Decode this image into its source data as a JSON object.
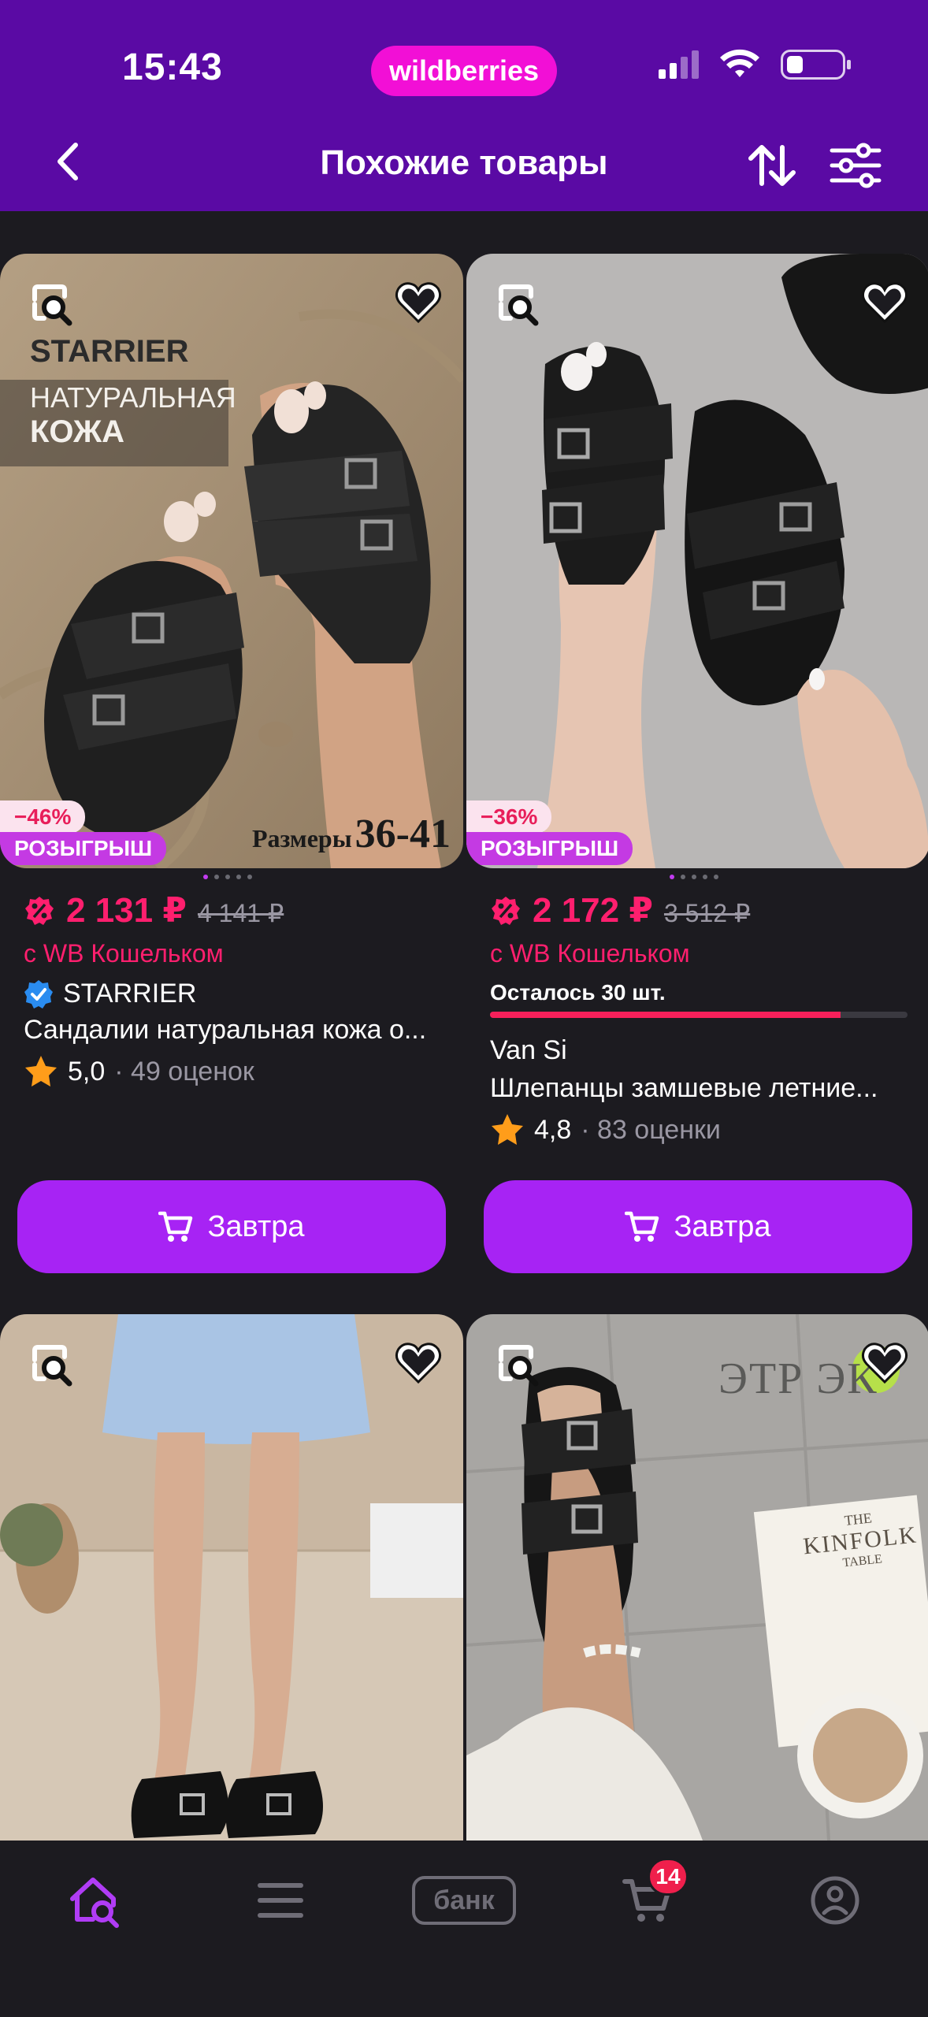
{
  "status_bar": {
    "time": "15:43",
    "brand": "wildberries"
  },
  "header": {
    "title": "Похожие товары"
  },
  "products": [
    {
      "discount": "−46%",
      "promo": "РОЗЫГРЫШ",
      "price": "2 131 ₽",
      "old_price": "4 141 ₽",
      "wallet_note": "с WB Кошельком",
      "brand": "STARRIER",
      "verified": true,
      "title": "Сандалии натуральная кожа о...",
      "rating": "5,0",
      "reviews": "· 49 оценок",
      "button": "Завтра",
      "image_overlay": {
        "line1": "STARRIER",
        "line2": "НАТУРАЛЬНАЯ",
        "line3": "КОЖА",
        "sizes_label": "Размеры",
        "sizes": "36-41"
      }
    },
    {
      "discount": "−36%",
      "promo": "РОЗЫГРЫШ",
      "price": "2 172 ₽",
      "old_price": "3 512 ₽",
      "wallet_note": "с WB Кошельком",
      "stock_text": "Осталось 30 шт.",
      "stock_level": 0.84,
      "brand": "Van Si",
      "title": "Шлепанцы замшевые летние...",
      "rating": "4,8",
      "reviews": "· 83 оценки",
      "button": "Завтра"
    },
    {
      "image_overlay": {}
    },
    {
      "image_overlay": {
        "logo": "ЭТР ЭК",
        "book_line1": "THE",
        "book_line2": "KINFOLK",
        "book_line3": "TABLE"
      }
    }
  ],
  "bottom_nav": {
    "bank_label": "банк",
    "cart_count": "14"
  },
  "colors": {
    "header": "#5a0aa4",
    "accent": "#a723f4",
    "price": "#ff1f6e",
    "brand_pill": "#f20fd6"
  }
}
